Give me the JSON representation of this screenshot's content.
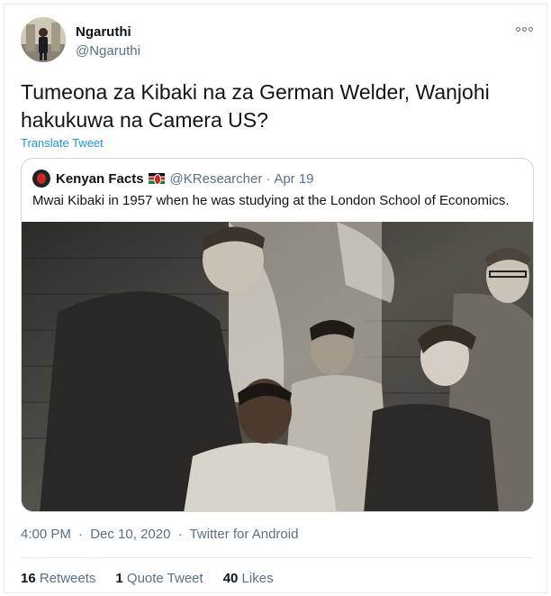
{
  "author": {
    "name": "Ngaruthi",
    "handle": "@Ngaruthi"
  },
  "tweet": {
    "text": "Tumeona za Kibaki na za German Welder, Wanjohi hakukuwa na Camera US?",
    "translate_label": "Translate Tweet"
  },
  "quoted": {
    "name": "Kenyan Facts",
    "handle": "@KResearcher",
    "separator": "·",
    "date": "Apr 19",
    "text": "Mwai Kibaki in 1957 when he was studying at the London School of Economics."
  },
  "meta": {
    "time": "4:00 PM",
    "separator": "·",
    "date": "Dec 10, 2020",
    "client": "Twitter for Android"
  },
  "stats": {
    "retweets_count": "16",
    "retweets_label": "Retweets",
    "quotes_count": "1",
    "quotes_label": "Quote Tweet",
    "likes_count": "40",
    "likes_label": "Likes"
  },
  "colors": {
    "link": "#1b95e0",
    "secondary_text": "#5b7083",
    "border": "#e6ecf0"
  }
}
